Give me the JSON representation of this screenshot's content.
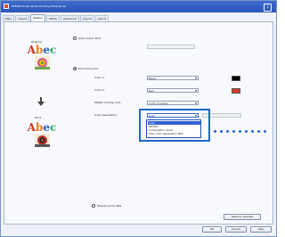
{
  "window": {
    "title": "EPSON SC-P6 Series Printing Preferences",
    "help": "?"
  },
  "tabs": [
    "Main",
    "Layout",
    "Pattern",
    "Utility",
    "Advanced",
    "Layout",
    "About"
  ],
  "active_tab_index": 2,
  "preview": {
    "original_label": "Original",
    "print_label": "Print",
    "sample_text": [
      "A",
      "b",
      "e",
      "c"
    ]
  },
  "settings": {
    "auto_color_label": "Auto Colour Print",
    "auto_color_value": "",
    "duotone_label": "Duo-tone print",
    "color1_label": "Color 1:",
    "color1_value": "Black",
    "color1_hex": "#000000",
    "color2_label": "Color 2:",
    "color2_value": "Red",
    "color2_hex": "#d83a2a",
    "master_label": "Master mixing color:",
    "master_value": "Color of Colour",
    "separation_label": "Color separation:",
    "separation_value": "Auto"
  },
  "dropdown_options": [
    "Auto",
    "Off/Std",
    "Composition print",
    "Free color separation (EX)"
  ],
  "dropdown_selected_index": 0,
  "preview_print_label": "Preview print data",
  "buttons": {
    "restore": "Restore defaults",
    "ok": "OK",
    "cancel": "Cancel",
    "help": "Help"
  },
  "colors": {
    "accent": "#1e66c9",
    "title": "#2a56b8"
  },
  "icons": [
    "printer-icon",
    "help-icon",
    "down-arrow-icon",
    "flower-icon",
    "dropdown-arrow-icon"
  ]
}
